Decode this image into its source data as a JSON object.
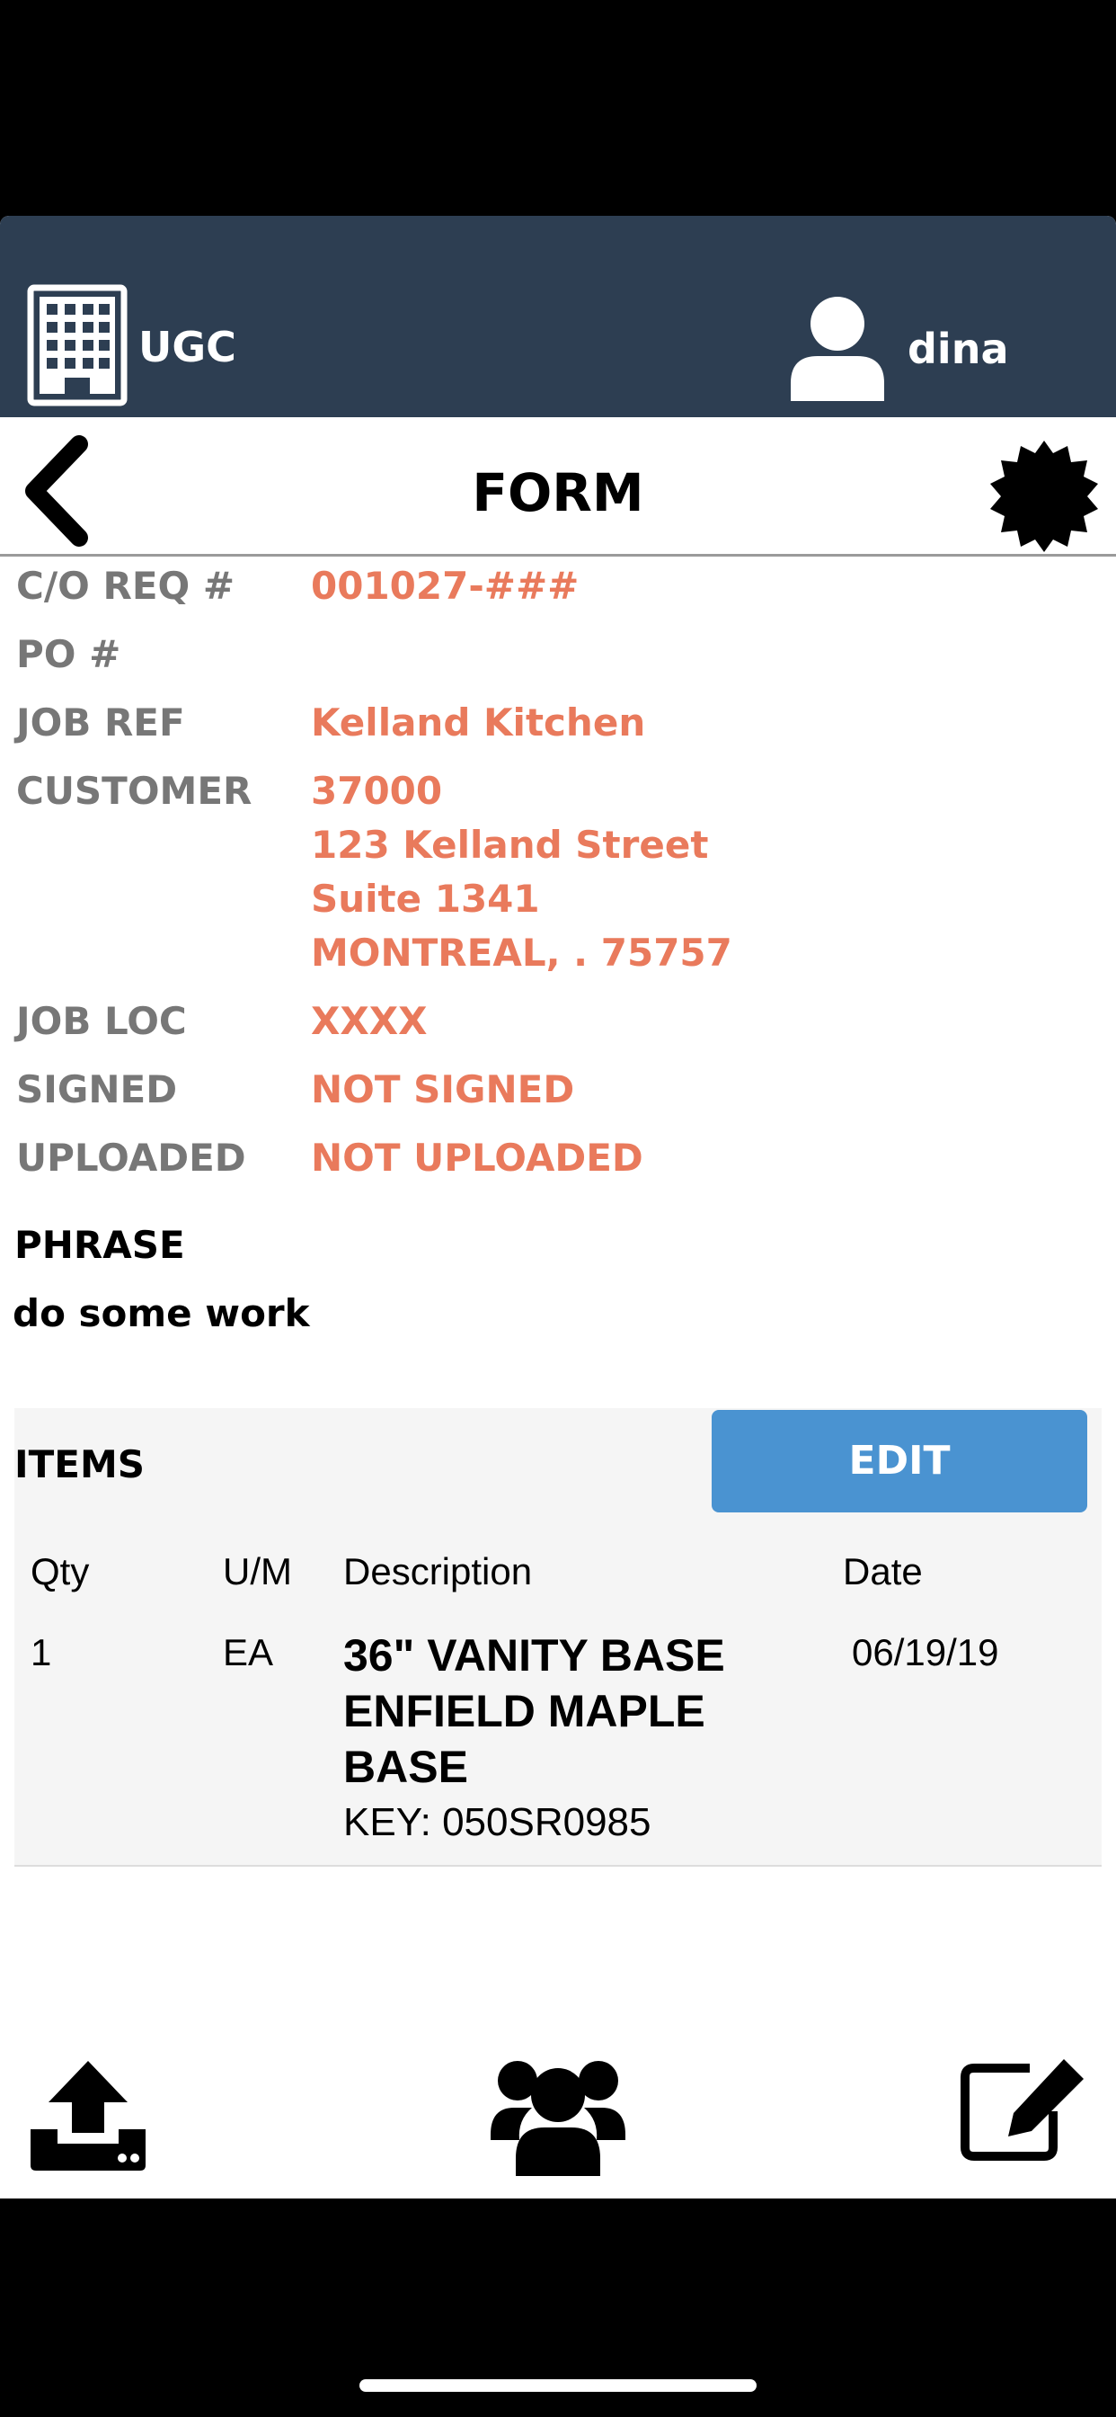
{
  "header": {
    "org_name": "UGC",
    "user_name": "dina"
  },
  "nav": {
    "title": "FORM"
  },
  "details": {
    "co_req": {
      "label": "C/O REQ #",
      "value": "001027-###"
    },
    "po": {
      "label": "PO #",
      "value": ""
    },
    "job_ref": {
      "label": "JOB REF",
      "value": "Kelland Kitchen"
    },
    "customer": {
      "label": "CUSTOMER",
      "lines": [
        "37000",
        "123 Kelland Street",
        "Suite 1341",
        "MONTREAL, . 75757"
      ]
    },
    "job_loc": {
      "label": "JOB LOC",
      "value": "XXXX"
    },
    "signed": {
      "label": "SIGNED",
      "value": "NOT SIGNED"
    },
    "uploaded": {
      "label": "UPLOADED",
      "value": "NOT UPLOADED"
    }
  },
  "phrase": {
    "label": "PHRASE",
    "value": "do some work"
  },
  "items": {
    "heading": "ITEMS",
    "edit_label": "EDIT",
    "columns": [
      "Qty",
      "U/M",
      "Description",
      "Date"
    ],
    "rows": [
      {
        "qty": "1",
        "um": "EA",
        "description": "36\" VANITY BASE ENFIELD MAPLE BASE",
        "key": "KEY: 050SR0985",
        "date": "06/19/19"
      }
    ]
  },
  "icons": {
    "org": "building-icon",
    "user": "user-icon",
    "back": "chevron-left-icon",
    "settings": "badge-gear-icon",
    "upload": "upload-icon",
    "team": "users-icon",
    "edit": "edit-icon"
  },
  "colors": {
    "header_bg": "#2d3e52",
    "value_text": "#e97a5c",
    "label_text": "#777777",
    "edit_button": "#4a93d1"
  }
}
